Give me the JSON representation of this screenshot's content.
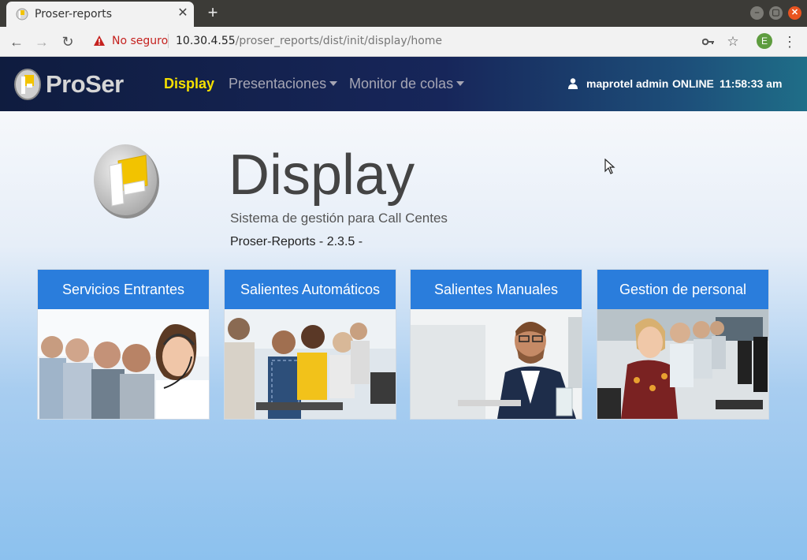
{
  "browser": {
    "tab_title": "Proser-reports",
    "new_tab_symbol": "+",
    "security_label": "No seguro",
    "url_host": "10.30.4.55",
    "url_path": "/proser_reports/dist/init/display/home",
    "profile_initial": "E"
  },
  "navbar": {
    "brand": "ProSer",
    "links": [
      {
        "label": "Display"
      },
      {
        "label": "Presentaciones"
      },
      {
        "label": "Monitor de colas"
      }
    ],
    "user": "maprotel admin",
    "status": "ONLINE",
    "clock": "11:58:33 am"
  },
  "hero": {
    "title": "Display",
    "subtitle": "Sistema de gestión para Call Centes",
    "version": "Proser-Reports - 2.3.5 -"
  },
  "cards": [
    {
      "title": "Servicios Entrantes"
    },
    {
      "title": "Salientes Automáticos"
    },
    {
      "title": "Salientes Manuales"
    },
    {
      "title": "Gestion de personal"
    }
  ],
  "colors": {
    "accent": "#2a7ddc",
    "active_link": "#f5e000",
    "navbar": "#17265a",
    "warning": "#c5221f"
  },
  "icons": [
    "favicon-icon",
    "close-icon",
    "back-arrow-icon",
    "forward-arrow-icon",
    "reload-icon",
    "warning-icon",
    "key-icon",
    "star-icon",
    "menu-dots-icon",
    "user-icon",
    "caret-down-icon"
  ]
}
